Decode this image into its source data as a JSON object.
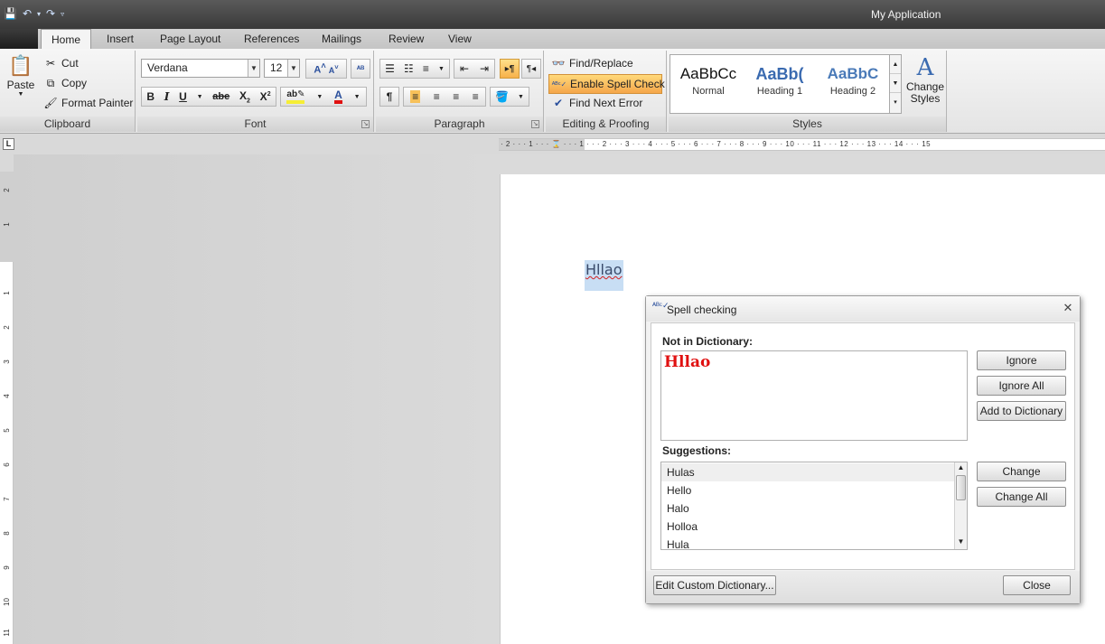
{
  "window": {
    "title": "My Application"
  },
  "qat": {
    "save_icon": "save-icon",
    "undo_icon": "undo-icon",
    "redo_icon": "redo-icon",
    "customize_icon": "customize-icon"
  },
  "tabs": [
    "Home",
    "Insert",
    "Page Layout",
    "References",
    "Mailings",
    "Review",
    "View"
  ],
  "clipboard": {
    "paste": "Paste",
    "cut": "Cut",
    "copy": "Copy",
    "format_painter": "Format Painter",
    "label": "Clipboard"
  },
  "font": {
    "family": "Verdana",
    "size": "12",
    "label": "Font",
    "bold": "B",
    "italic": "I",
    "underline": "U",
    "strike": "abe",
    "subscript": "X",
    "superscript": "X"
  },
  "paragraph": {
    "label": "Paragraph",
    "pilcrow": "¶"
  },
  "editing": {
    "find_replace": "Find/Replace",
    "spell_check": "Enable Spell Check",
    "find_next_error": "Find Next Error",
    "label": "Editing & Proofing"
  },
  "styles": {
    "label": "Styles",
    "items": [
      {
        "sample": "AaBbCc",
        "name": "Normal"
      },
      {
        "sample": "AaBb(",
        "name": "Heading 1"
      },
      {
        "sample": "AaBbC",
        "name": "Heading 2"
      }
    ],
    "change_styles_line1": "Change",
    "change_styles_line2": "Styles"
  },
  "ruler": {
    "horizontal": "· 2 · · · 1 · · · ⌛ · · · 1 · · · 2 · · · 3 · · · 4 · · · 5 · · · 6 · · · 7 · · · 8 · · · 9 · · · 10 · · · 11 · · · 12 · · · 13 · · · 14 · · · 15",
    "vertical_numbers": [
      "2",
      "1",
      "1",
      "2",
      "3",
      "4",
      "5",
      "6",
      "7",
      "8",
      "9",
      "10",
      "11"
    ],
    "tab_selector": "L"
  },
  "document": {
    "word": "Hllao"
  },
  "dialog": {
    "title": "Spell checking",
    "not_in_dictionary_label": "Not in Dictionary:",
    "not_in_dictionary_word": "Hllao",
    "ignore": "Ignore",
    "ignore_all": "Ignore All",
    "add_to_dictionary": "Add to Dictionary",
    "suggestions_label": "Suggestions:",
    "suggestions": [
      "Hulas",
      "Hello",
      "Halo",
      "Holloa",
      "Hula"
    ],
    "change": "Change",
    "change_all": "Change All",
    "edit_custom_dictionary": "Edit Custom Dictionary...",
    "close": "Close"
  }
}
